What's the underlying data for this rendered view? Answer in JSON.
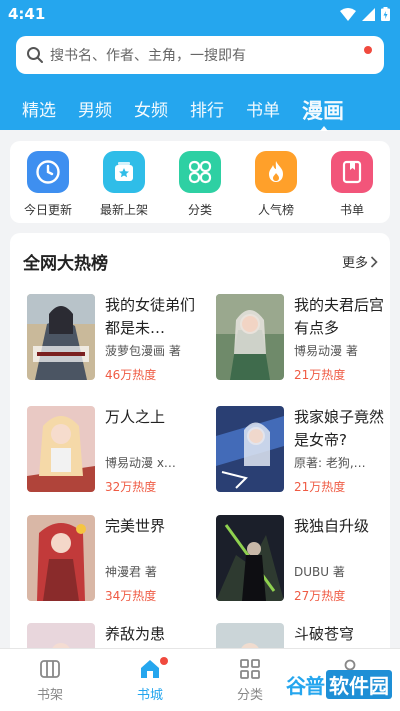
{
  "status_bar": {
    "time": "4:41"
  },
  "search": {
    "placeholder": "搜书名、作者、主角，一搜即有"
  },
  "tabs": [
    {
      "label": "精选"
    },
    {
      "label": "男频"
    },
    {
      "label": "女频"
    },
    {
      "label": "排行"
    },
    {
      "label": "书单"
    },
    {
      "label": "漫画",
      "active": true
    }
  ],
  "quick": [
    {
      "label": "今日更新",
      "icon": "clock-icon",
      "color": "#3e8ff0"
    },
    {
      "label": "最新上架",
      "icon": "new-shelf-icon",
      "color": "#2fbde8"
    },
    {
      "label": "分类",
      "icon": "category-icon",
      "color": "#2ed0a3"
    },
    {
      "label": "人气榜",
      "icon": "flame-icon",
      "color": "#ffa02a"
    },
    {
      "label": "书单",
      "icon": "booklist-icon",
      "color": "#f2557a"
    }
  ],
  "rank": {
    "title": "全网大热榜",
    "more": "更多",
    "books": [
      {
        "title": "我的女徒弟们都是未…",
        "author": "菠萝包漫画 著",
        "heat": "46万热度"
      },
      {
        "title": "我的夫君后宫有点多",
        "author": "博易动漫 著",
        "heat": "21万热度"
      },
      {
        "title": "万人之上",
        "author": "博易动漫 x…",
        "heat": "32万热度"
      },
      {
        "title": "我家娘子竟然是女帝?",
        "author": "原著: 老狗,…",
        "heat": "21万热度"
      },
      {
        "title": "完美世界",
        "author": "神漫君 著",
        "heat": "34万热度"
      },
      {
        "title": "我独自升级",
        "author": "DUBU 著",
        "heat": "27万热度"
      },
      {
        "title": "养敌为患",
        "author": "",
        "heat": ""
      },
      {
        "title": "斗破苍穹",
        "author": "",
        "heat": ""
      }
    ]
  },
  "bottom_nav": [
    {
      "label": "书架",
      "icon": "bookshelf-icon"
    },
    {
      "label": "书城",
      "icon": "home-icon",
      "active": true
    },
    {
      "label": "分类",
      "icon": "grid-icon"
    },
    {
      "label": "我的",
      "icon": "user-icon"
    }
  ],
  "watermark": {
    "part1": "谷普",
    "part2": "软件园"
  },
  "colors": {
    "accent": "#25a6ee",
    "heat": "#ef5b44",
    "badge": "#f04a3e"
  }
}
